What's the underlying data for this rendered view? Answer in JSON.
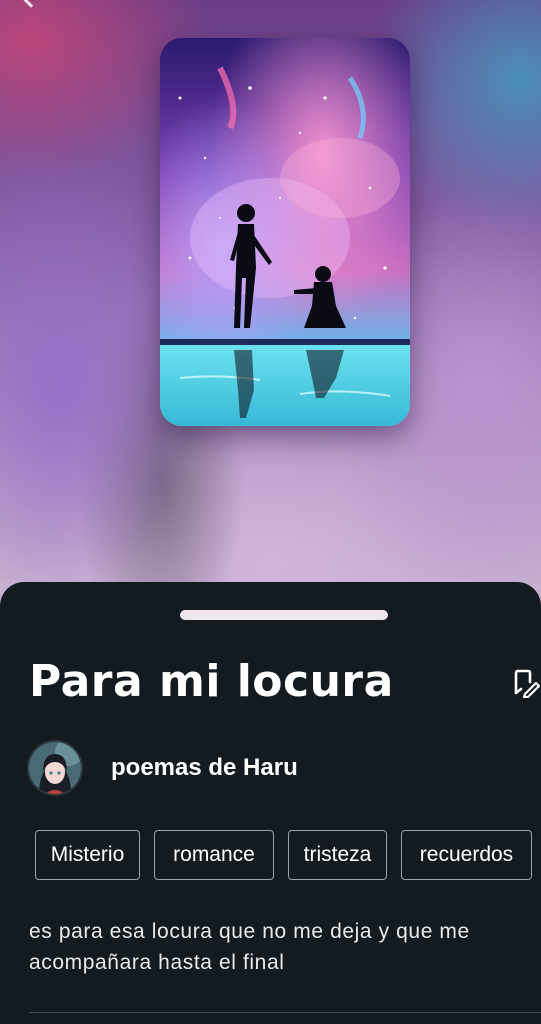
{
  "story": {
    "title": "Para mi locura",
    "author": "poemas de Haru",
    "tags": [
      "Misterio",
      "romance",
      "tristeza",
      "recuerdos"
    ],
    "description_lines": [
      "es para esa locura que no me deja y que me",
      "acompañara hasta el final"
    ]
  },
  "icons": {
    "back": "chevron-left-icon",
    "edit": "bookmark-edit-icon"
  },
  "colors": {
    "sheet_background": "#131b20",
    "handle": "#f0e6ef",
    "tag_border": "#9aa3a7",
    "text": "#ffffff"
  }
}
